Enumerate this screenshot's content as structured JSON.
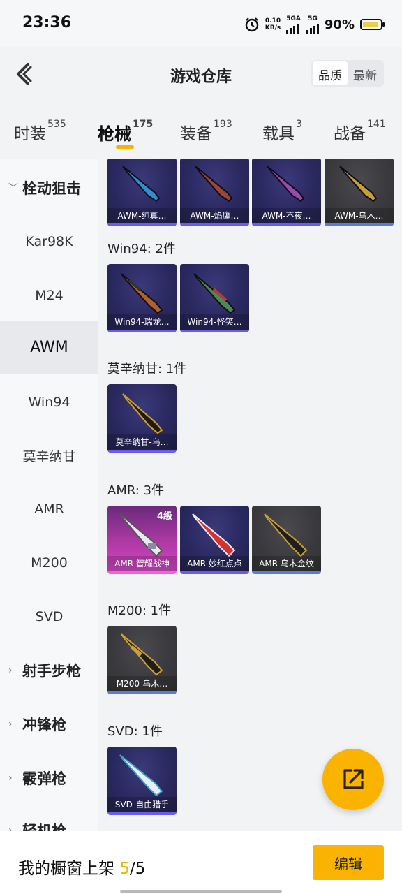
{
  "status": {
    "time": "23:36",
    "speed": "0.10",
    "speed_unit": "KB/s",
    "net1": "5GA",
    "net2": "5G",
    "battery": "90%"
  },
  "header": {
    "title": "游戏仓库",
    "sort_options": [
      "品质",
      "最新"
    ],
    "active_sort": "品质"
  },
  "tabs": [
    {
      "label": "时装",
      "count": "535"
    },
    {
      "label": "枪械",
      "count": "175"
    },
    {
      "label": "装备",
      "count": "193"
    },
    {
      "label": "载具",
      "count": "3"
    },
    {
      "label": "战备",
      "count": "141"
    }
  ],
  "sidebar": {
    "items": [
      {
        "label": "栓动狙击"
      },
      {
        "label": "Kar98K"
      },
      {
        "label": "M24"
      },
      {
        "label": "AWM"
      },
      {
        "label": "Win94"
      },
      {
        "label": "莫辛纳甘"
      },
      {
        "label": "AMR"
      },
      {
        "label": "M200"
      },
      {
        "label": "SVD"
      },
      {
        "label": "射手步枪"
      },
      {
        "label": "冲锋枪"
      },
      {
        "label": "霰弹枪"
      },
      {
        "label": "轻机枪"
      }
    ]
  },
  "sections": {
    "awm": {
      "cards": [
        {
          "label": "AWM-纯真…"
        },
        {
          "label": "AWM-焰鹰…"
        },
        {
          "label": "AWM-不夜…"
        },
        {
          "label": "AWM-乌木…"
        }
      ]
    },
    "win94": {
      "title": "Win94: 2件",
      "cards": [
        {
          "label": "Win94-瑞龙…"
        },
        {
          "label": "Win94-怪笑…"
        }
      ]
    },
    "mosin": {
      "title": "莫辛纳甘: 1件",
      "cards": [
        {
          "label": "莫辛纳甘-乌…"
        }
      ]
    },
    "amr": {
      "title": "AMR: 3件",
      "cards": [
        {
          "label": "AMR-智耀战神",
          "level": "4级"
        },
        {
          "label": "AMR-妙红点点"
        },
        {
          "label": "AMR-乌木金纹"
        }
      ]
    },
    "m200": {
      "title": "M200: 1件",
      "cards": [
        {
          "label": "M200-乌木…"
        }
      ]
    },
    "svd": {
      "title": "SVD: 1件",
      "cards": [
        {
          "label": "SVD-自由猎手"
        }
      ]
    }
  },
  "bottom": {
    "prefix": "我的橱窗上架",
    "current": "5",
    "total": "/5",
    "edit_label": "编辑"
  },
  "colors": {
    "accent": "#f9b300",
    "rarity_purple": "#6b5cf0",
    "rarity_pink": "#f062d8",
    "rarity_blue": "#5a7bd8"
  }
}
